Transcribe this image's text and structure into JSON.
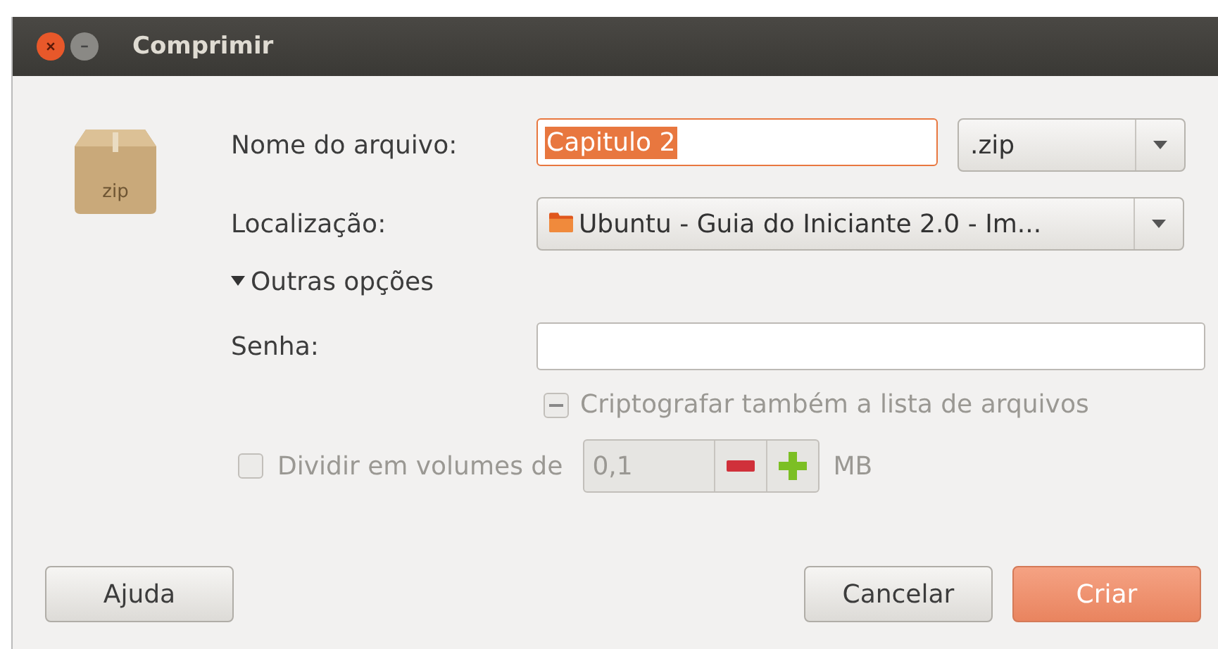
{
  "window": {
    "title": "Comprimir"
  },
  "archive_icon": {
    "label": "zip"
  },
  "filename": {
    "label": "Nome do arquivo:",
    "value": "Capitulo 2",
    "selected": true
  },
  "extension": {
    "value": ".zip"
  },
  "location": {
    "label": "Localização:",
    "value": "Ubuntu - Guia do Iniciante 2.0 - Im..."
  },
  "expander": {
    "label": "Outras opções",
    "expanded": true
  },
  "password": {
    "label": "Senha:"
  },
  "encrypt_list": {
    "label": "Criptografar também a lista de arquivos",
    "indeterminate": true,
    "disabled": true
  },
  "split": {
    "label": "Dividir em volumes de",
    "checked": false,
    "disabled": true,
    "value": "0,1",
    "unit": "MB"
  },
  "buttons": [
    {
      "label": "Ajuda",
      "kind": "normal"
    },
    {
      "label": "Cancelar",
      "kind": "normal"
    },
    {
      "label": "Criar",
      "kind": "default"
    }
  ]
}
